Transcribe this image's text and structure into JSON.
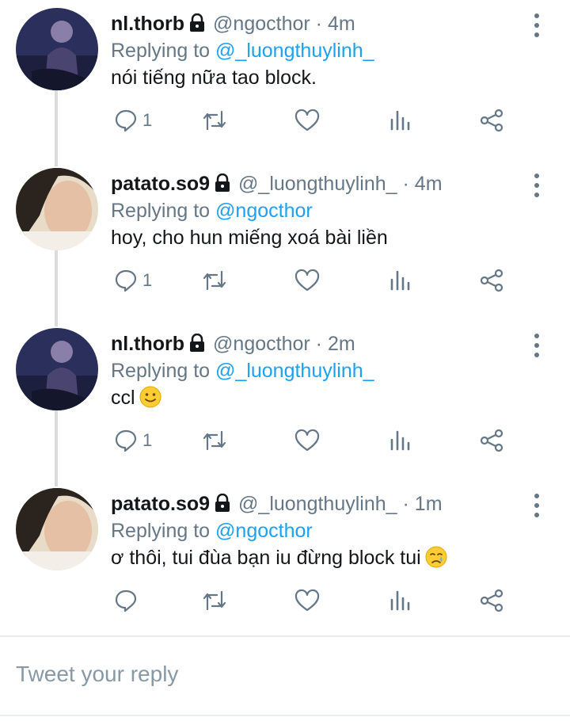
{
  "tweets": [
    {
      "name": "nl.thorb",
      "handle": "@ngocthor",
      "dot": "·",
      "time": "4m",
      "replying_prefix": "Replying to",
      "replying_to": "@_luongthuylinh_",
      "text": "nói tiếng nữa tao block.",
      "reply_count": "1",
      "emoji": ""
    },
    {
      "name": "patato.so9",
      "handle": "@_luongthuylinh_",
      "dot": "·",
      "time": "4m",
      "replying_prefix": "Replying to",
      "replying_to": "@ngocthor",
      "text": "hoy, cho hun miếng xoá bài liền",
      "reply_count": "1",
      "emoji": ""
    },
    {
      "name": "nl.thorb",
      "handle": "@ngocthor",
      "dot": "·",
      "time": "2m",
      "replying_prefix": "Replying to",
      "replying_to": "@_luongthuylinh_",
      "text": "ccl",
      "reply_count": "1",
      "emoji": "slightly-smiling-face"
    },
    {
      "name": "patato.so9",
      "handle": "@_luongthuylinh_",
      "dot": "·",
      "time": "1m",
      "replying_prefix": "Replying to",
      "replying_to": "@ngocthor",
      "text": "ơ thôi, tui đùa bạn iu đừng block tui",
      "reply_count": "",
      "emoji": "crying-face"
    }
  ],
  "compose": {
    "placeholder": "Tweet your reply"
  },
  "colors": {
    "link": "#1da1f2",
    "muted": "#657786",
    "thread": "#dcdcdc"
  }
}
